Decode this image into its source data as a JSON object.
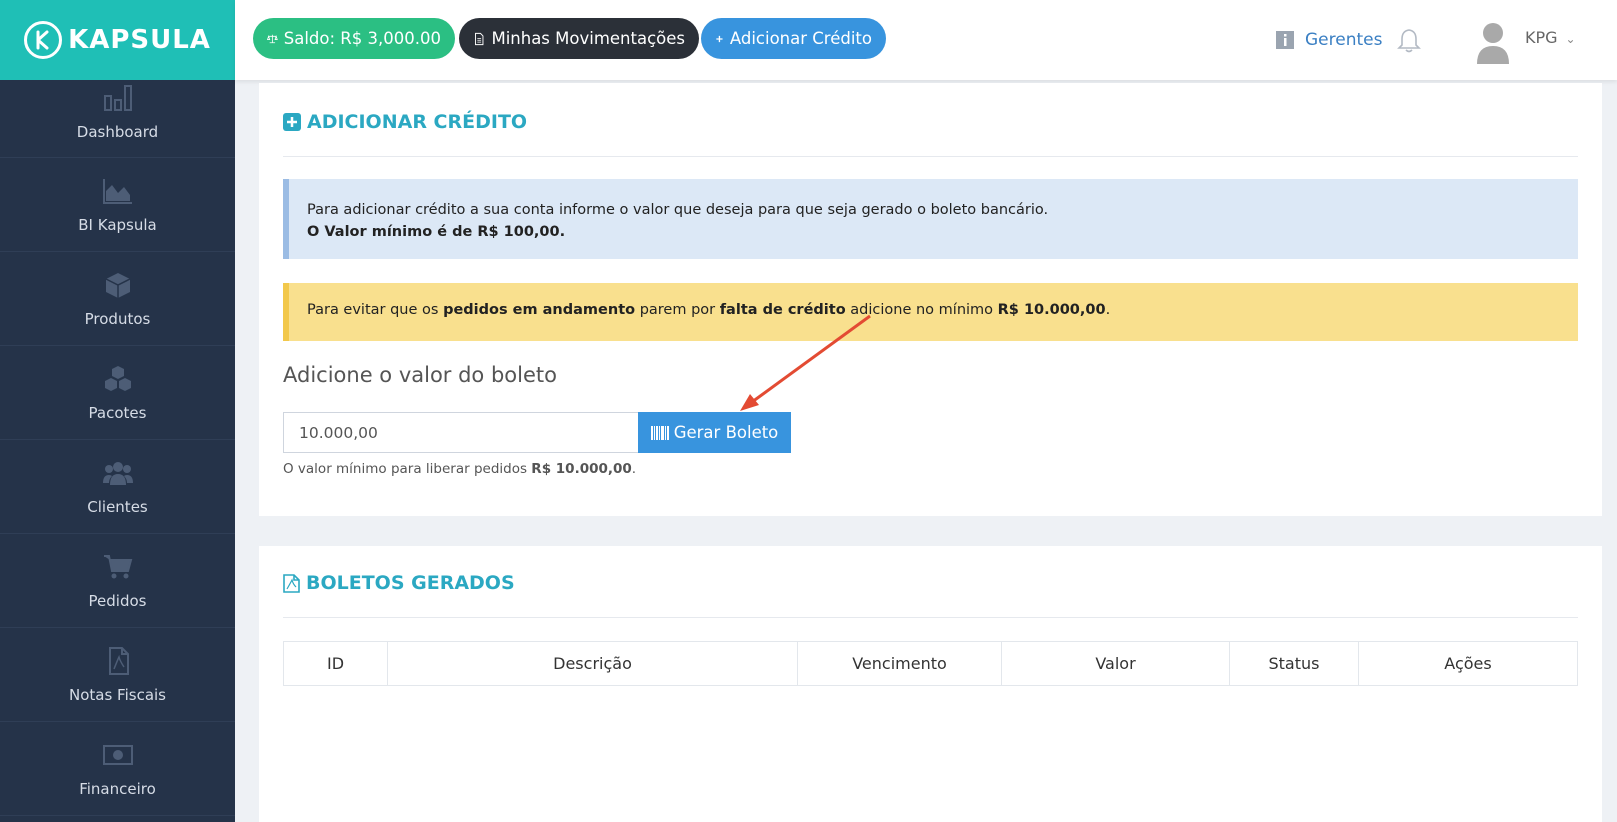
{
  "brand": {
    "name": "KAPSULA",
    "color": "#1fbfb6"
  },
  "sidebar": {
    "items": [
      {
        "label": "Dashboard",
        "icon": "bar-chart-icon"
      },
      {
        "label": "BI Kapsula",
        "icon": "area-chart-icon"
      },
      {
        "label": "Produtos",
        "icon": "cube-icon"
      },
      {
        "label": "Pacotes",
        "icon": "cubes-icon"
      },
      {
        "label": "Clientes",
        "icon": "users-icon"
      },
      {
        "label": "Pedidos",
        "icon": "cart-icon"
      },
      {
        "label": "Notas Fiscais",
        "icon": "file-pdf-icon"
      },
      {
        "label": "Financeiro",
        "icon": "money-icon"
      }
    ]
  },
  "topbar": {
    "saldo_label": "Saldo: R$ 3,000.00",
    "movimentacoes_label": "Minhas Movimentações",
    "adicionar_label": "Adicionar Crédito",
    "gerentes_label": "Gerentes",
    "user_name": "KPG"
  },
  "credito": {
    "title": "ADICIONAR CRÉDITO",
    "info_line1": "Para adicionar crédito a sua conta informe o valor que deseja para que seja gerado o boleto bancário.",
    "info_line2": "O Valor mínimo é de R$ 100,00.",
    "warn_part1": "Para evitar que os ",
    "warn_bold1": "pedidos em andamento",
    "warn_part2": " parem por ",
    "warn_bold2": "falta de crédito",
    "warn_part3": " adicione no mínimo ",
    "warn_bold3": "R$ 10.000,00",
    "warn_part4": ".",
    "field_label": "Adicione o valor do boleto",
    "field_value": "10.000,00",
    "button_label": "Gerar Boleto",
    "hint_text": "O valor mínimo para liberar pedidos ",
    "hint_bold": "R$ 10.000,00",
    "hint_end": "."
  },
  "boletos": {
    "title": "BOLETOS GERADOS",
    "columns": [
      "ID",
      "Descrição",
      "Vencimento",
      "Valor",
      "Status",
      "Ações"
    ]
  }
}
